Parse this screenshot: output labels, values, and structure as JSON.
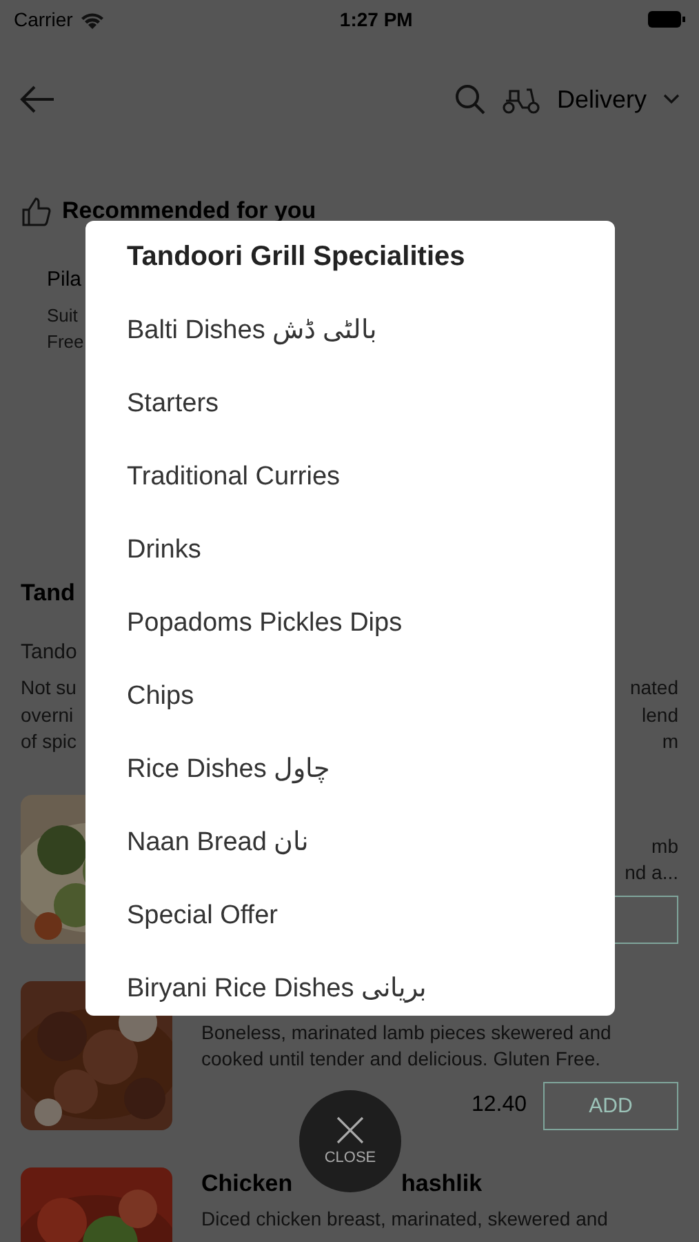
{
  "status_bar": {
    "carrier": "Carrier",
    "time": "1:27 PM"
  },
  "header": {
    "mode": "Delivery"
  },
  "recommended": {
    "title": "Recommended for you",
    "card_name": "Pila",
    "card_lines": [
      "Suit",
      "Free"
    ]
  },
  "section": {
    "title": "Tand",
    "subtitle": "Tando",
    "description_lines": [
      {
        "left": "Not su",
        "right": "nated"
      },
      {
        "left": "overni",
        "right": "lend"
      },
      {
        "left": "of spic",
        "right": "m"
      }
    ]
  },
  "items": [
    {
      "kind": "partial",
      "description_lines": [
        "mb",
        "nd a..."
      ]
    },
    {
      "kind": "full",
      "description_lines": [
        "Boneless, marinated lamb pieces skewered and",
        "cooked until tender and delicious. Gluten Free."
      ],
      "price": "12.40",
      "button": "ADD"
    },
    {
      "kind": "full",
      "title_parts": [
        "Chicken",
        "hashlik"
      ],
      "description_lines": [
        "Diced chicken breast, marinated, skewered and"
      ]
    }
  ],
  "modal": {
    "title": "Tandoori Grill Specialities",
    "items": [
      {
        "label": "Balti Dishes بالٹی ڈش"
      },
      {
        "label": "Starters"
      },
      {
        "label": "Traditional Curries"
      },
      {
        "label": "Drinks"
      },
      {
        "label": "Popadoms Pickles Dips"
      },
      {
        "label": "Chips"
      },
      {
        "label": "Rice Dishes چاول"
      },
      {
        "label": "Naan Bread نان"
      },
      {
        "label": "Special Offer"
      },
      {
        "label": "Biryani Rice Dishes بریانی"
      }
    ]
  },
  "close_button": {
    "label": "CLOSE"
  }
}
